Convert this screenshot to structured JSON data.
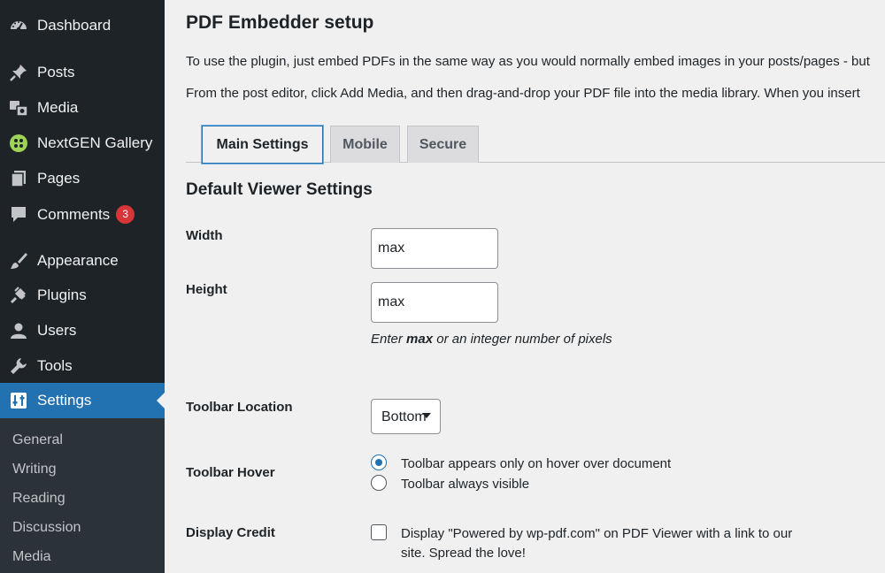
{
  "colors": {
    "sidebar_bg": "#1d2327",
    "submenu_bg": "#2c3338",
    "accent": "#2271b1",
    "badge": "#d63638",
    "page_bg": "#f0f0f1"
  },
  "sidebar": {
    "items": [
      {
        "label": "Dashboard",
        "icon": "dashboard-icon"
      },
      {
        "label": "Posts",
        "icon": "pin-icon"
      },
      {
        "label": "Media",
        "icon": "media-icon"
      },
      {
        "label": "NextGEN Gallery",
        "icon": "nextgen-icon"
      },
      {
        "label": "Pages",
        "icon": "pages-icon"
      },
      {
        "label": "Comments",
        "icon": "comment-icon",
        "badge": "3"
      },
      {
        "label": "Appearance",
        "icon": "brush-icon"
      },
      {
        "label": "Plugins",
        "icon": "plug-icon"
      },
      {
        "label": "Users",
        "icon": "user-icon"
      },
      {
        "label": "Tools",
        "icon": "wrench-icon"
      },
      {
        "label": "Settings",
        "icon": "settings-icon",
        "active": true
      }
    ],
    "submenu": [
      "General",
      "Writing",
      "Reading",
      "Discussion",
      "Media"
    ]
  },
  "main": {
    "title": "PDF Embedder setup",
    "intro_1": "To use the plugin, just embed PDFs in the same way as you would normally embed images in your posts/pages - but",
    "intro_2": "From the post editor, click Add Media, and then drag-and-drop your PDF file into the media library. When you insert",
    "tabs": [
      {
        "label": "Main Settings",
        "active": true
      },
      {
        "label": "Mobile"
      },
      {
        "label": "Secure"
      }
    ],
    "section_title": "Default Viewer Settings",
    "width": {
      "label": "Width",
      "value": "max"
    },
    "height": {
      "label": "Height",
      "value": "max"
    },
    "help_max": "max",
    "help_rest": " or an integer number of pixels",
    "help_enter": "Enter ",
    "toolbar_location": {
      "label": "Toolbar Location",
      "value": "Bottom"
    },
    "toolbar_hover": {
      "label": "Toolbar Hover",
      "options": [
        {
          "label": "Toolbar appears only on hover over document",
          "checked": true
        },
        {
          "label": "Toolbar always visible",
          "checked": false
        }
      ]
    },
    "display_credit": {
      "label": "Display Credit",
      "text": "Display \"Powered by wp-pdf.com\" on PDF Viewer with a link to our site. Spread the love!",
      "checked": false
    }
  }
}
